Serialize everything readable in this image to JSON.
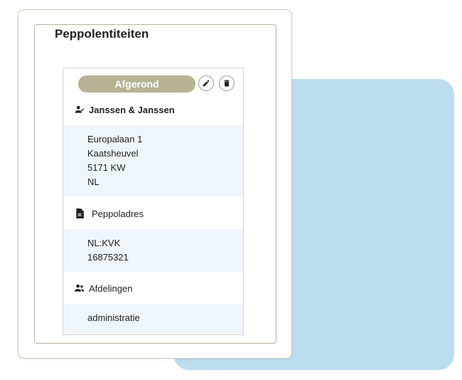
{
  "page": {
    "title": "Peppolentiteiten"
  },
  "entity": {
    "status": "Afgerond",
    "name": "Janssen & Janssen",
    "address_lines": [
      "Europalaan 1",
      "Kaatsheuvel",
      "5171 KW",
      "NL"
    ],
    "peppol_label": "Peppoladres",
    "peppol_lines": [
      "NL:KVK",
      "16875321"
    ],
    "departments_label": "Afdelingen",
    "departments": [
      "administratie"
    ]
  },
  "icons": {
    "edit": "pencil-icon",
    "delete": "trash-icon",
    "name": "person-check-icon",
    "peppol": "document-icon",
    "departments": "group-icon"
  },
  "colors": {
    "status_pill": "#b5b394",
    "background_blob": "#bcdcf0",
    "section_fill": "#eef5fb"
  }
}
